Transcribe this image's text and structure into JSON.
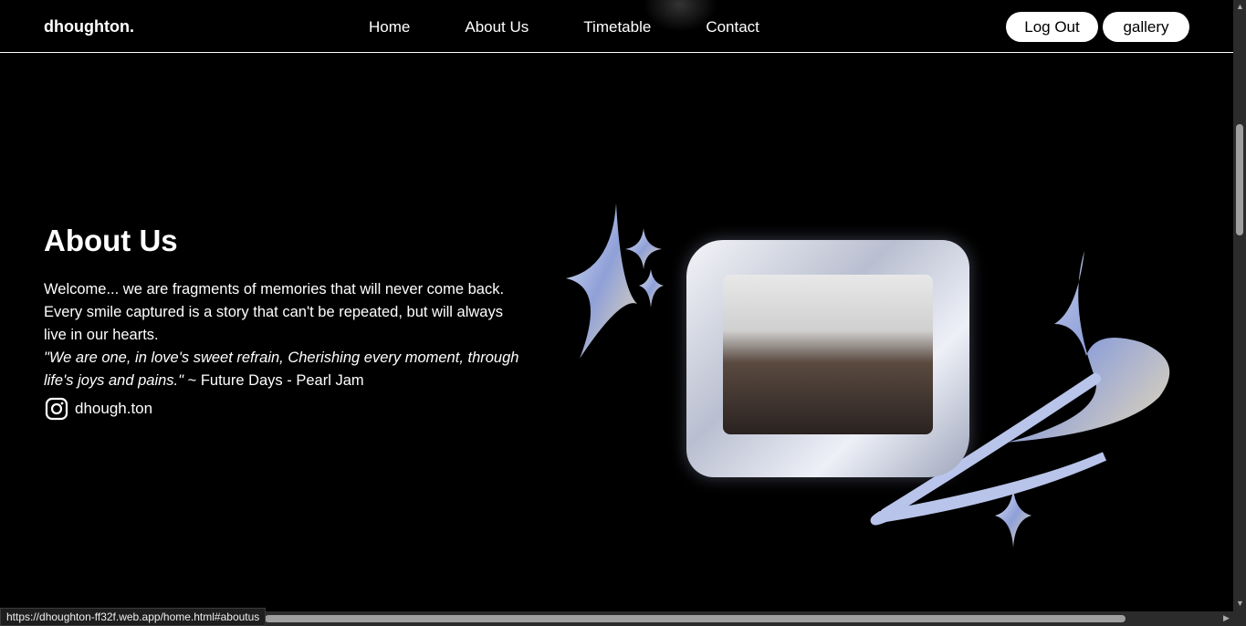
{
  "nav": {
    "logo": "dhoughton.",
    "links": [
      "Home",
      "About Us",
      "Timetable",
      "Contact"
    ],
    "logout": "Log Out",
    "gallery": "gallery"
  },
  "about": {
    "title": "About Us",
    "body": "Welcome... we are fragments of memories that will never come back. Every smile captured is a story that can't be repeated, but will always live in our hearts.",
    "quote": "\"We are one, in love's sweet refrain, Cherishing every moment, through life's joys and pains.\"",
    "attribution": " ~ Future Days - Pearl Jam",
    "instagram": "dhough.ton"
  },
  "status_url": "https://dhoughton-ff32f.web.app/home.html#aboutus"
}
